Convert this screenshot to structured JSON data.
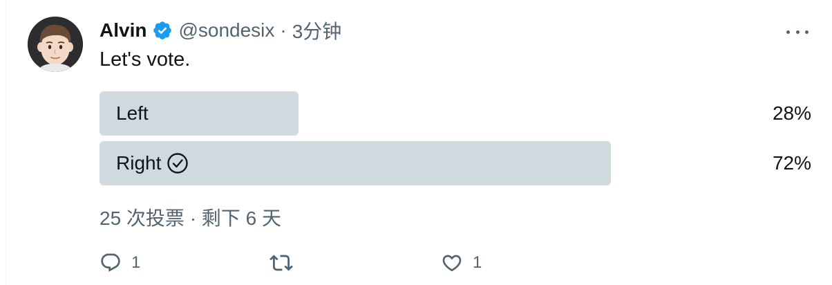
{
  "author": {
    "name": "Alvin",
    "handle": "@sondesix",
    "separator": "·",
    "time": "3分钟"
  },
  "tweet": {
    "text": "Let's vote."
  },
  "poll": {
    "options": [
      {
        "label": "Left",
        "percent_label": "28%",
        "percent": 28,
        "winner": false
      },
      {
        "label": "Right",
        "percent_label": "72%",
        "percent": 72,
        "winner": true
      }
    ],
    "meta": "25 次投票 · 剩下 6 天"
  },
  "actions": {
    "reply_count": "1",
    "retweet_count": "",
    "like_count": "1"
  },
  "icons": {
    "verified": "verified-badge-icon",
    "more": "more-options-icon",
    "reply": "reply-icon",
    "retweet": "retweet-icon",
    "like": "like-icon",
    "check": "check-circle-icon"
  },
  "colors": {
    "text_primary": "#0f1419",
    "text_secondary": "#536471",
    "poll_fill": "#cfd9de",
    "verified_blue": "#1d9bf0"
  }
}
